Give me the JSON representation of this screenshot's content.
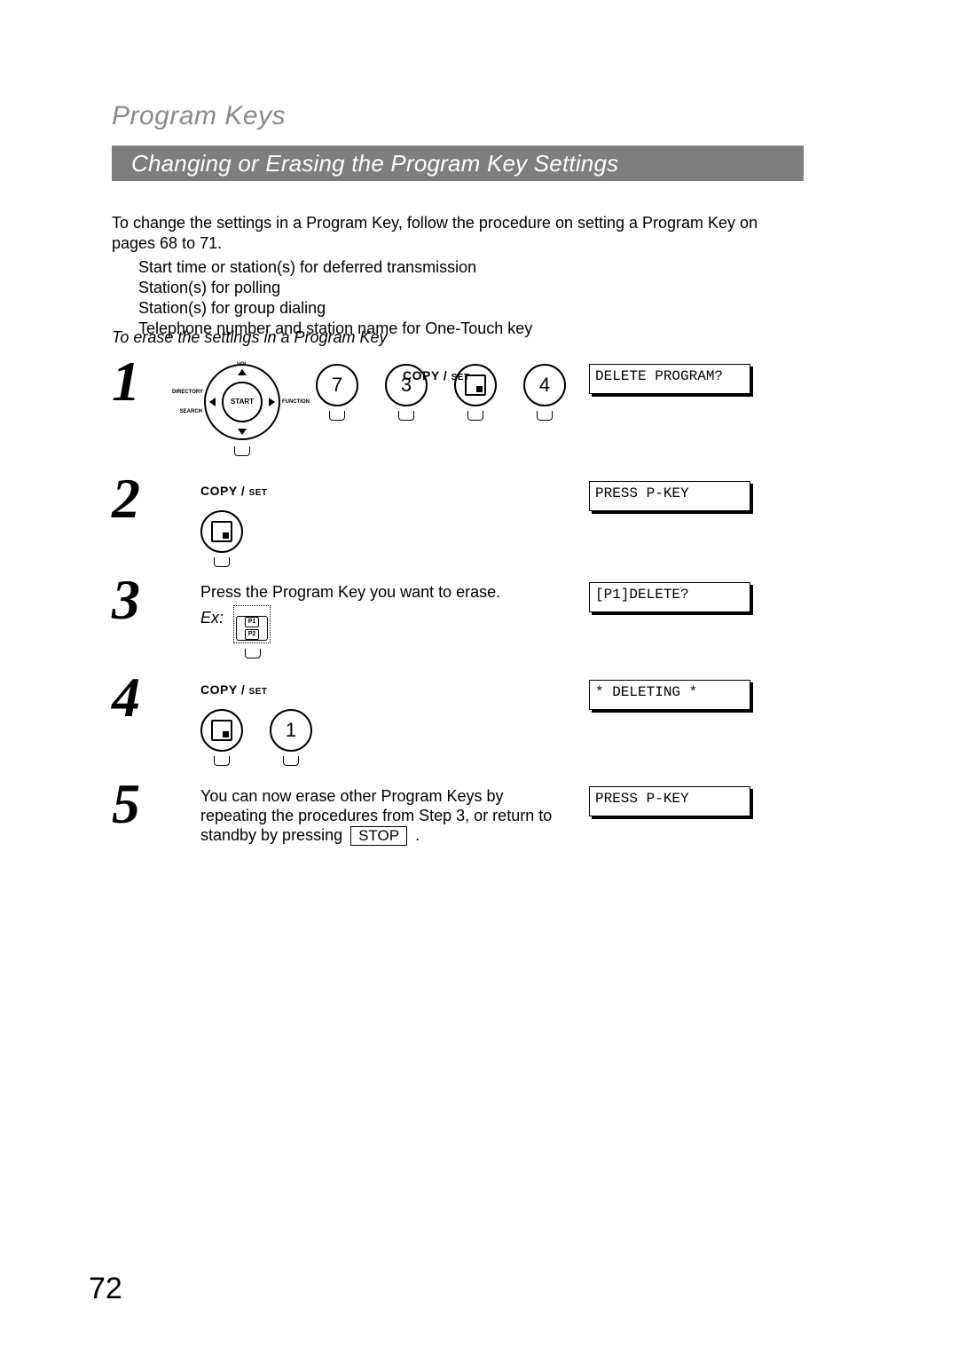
{
  "chapter_title": "Program Keys",
  "section_title": "Changing or Erasing the Program Key Settings",
  "intro_line": "To change the settings in a Program Key, follow the procedure on setting a Program Key on pages 68 to 71.",
  "intro_bullets": [
    "Start time or station(s) for deferred transmission",
    "Station(s) for polling",
    "Station(s) for group dialing",
    "Telephone number and station name for One-Touch key"
  ],
  "subtitle": "To erase the settings in a Program Key",
  "copy_set_label": "COPY / ",
  "copy_set_small": "SET",
  "nav_labels": {
    "top": "VOL",
    "left": "DIRECTORY SEARCH",
    "right": "FUNCTION",
    "center": "START"
  },
  "step1": {
    "num": "1",
    "keys": [
      "7",
      "3",
      "SET",
      "4"
    ],
    "lcd": "DELETE PROGRAM?"
  },
  "step2": {
    "num": "2",
    "lcd": "PRESS P-KEY"
  },
  "step3": {
    "num": "3",
    "text": "Press the Program Key you want to erase.",
    "ex_label": "Ex:",
    "p_labels": [
      "P1",
      "P2"
    ],
    "lcd": "[P1]DELETE?"
  },
  "step4": {
    "num": "4",
    "extra_key": "1",
    "lcd": "* DELETING *"
  },
  "step5": {
    "num": "5",
    "text_a": "You can now erase other Program Keys by repeating the procedures from Step 3, or return to standby by pressing ",
    "stop_label": "STOP",
    "text_b": " .",
    "lcd": "PRESS P-KEY"
  },
  "page_number": "72"
}
